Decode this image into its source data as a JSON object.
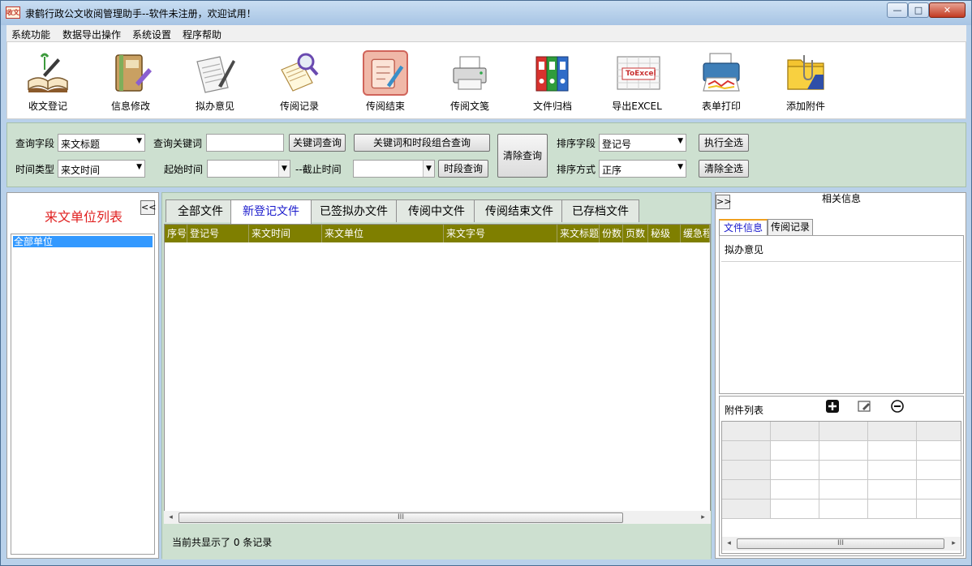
{
  "window": {
    "title": "隶鹤行政公文收阅管理助手--软件未注册，欢迎试用！",
    "icon_text": "收文",
    "minimize_label": "—",
    "maximize_label": "□",
    "close_label": "✕"
  },
  "menu": {
    "items": [
      "系统功能",
      "数据导出操作",
      "系统设置",
      "程序帮助"
    ]
  },
  "toolbar": {
    "items": [
      {
        "label": "收文登记",
        "icon": "open-book-icon"
      },
      {
        "label": "信息修改",
        "icon": "notebook-edit-icon"
      },
      {
        "label": "拟办意见",
        "icon": "document-pen-icon"
      },
      {
        "label": "传阅记录",
        "icon": "notes-magnifier-icon"
      },
      {
        "label": "传阅结束",
        "icon": "document-finish-icon"
      },
      {
        "label": "传阅文笺",
        "icon": "printer-small-icon"
      },
      {
        "label": "文件归档",
        "icon": "binders-icon"
      },
      {
        "label": "导出EXCEL",
        "icon": "excel-export-icon",
        "icon_text": "ToExcel"
      },
      {
        "label": "表单打印",
        "icon": "color-printer-icon"
      },
      {
        "label": "添加附件",
        "icon": "folder-clip-icon"
      }
    ]
  },
  "query": {
    "field_label": "查询字段",
    "field_value": "来文标题",
    "keyword_label": "查询关键词",
    "keyword_value": "",
    "keyword_search_button": "关键词查询",
    "combo_search_button": "关键词和时段组合查询",
    "clear_button": "清除查询",
    "sort_field_label": "排序字段",
    "sort_field_value": "登记号",
    "select_all_button": "执行全选",
    "time_type_label": "时间类型",
    "time_type_value": "来文时间",
    "start_label": "起始时间",
    "end_label": "--截止时间",
    "period_search_button": "时段查询",
    "sort_order_label": "排序方式",
    "sort_order_value": "正序",
    "clear_all_button": "清除全选"
  },
  "left": {
    "title": "来文单位列表",
    "collapse_label": "<<",
    "items": [
      "全部单位"
    ]
  },
  "center": {
    "tabs": [
      "全部文件",
      "新登记文件",
      "已签拟办文件",
      "传阅中文件",
      "传阅结束文件",
      "已存档文件"
    ],
    "active_tab": 1,
    "columns": [
      "序号",
      "登记号",
      "来文时间",
      "来文单位",
      "来文字号",
      "来文标题",
      "份数",
      "页数",
      "秘级",
      "缓急程"
    ],
    "rows": [],
    "status": "当前共显示了 0 条记录",
    "scroll_thumb_label": "III"
  },
  "right": {
    "title": "相关信息",
    "expand_label": ">>",
    "tabs": [
      "文件信息",
      "传阅记录"
    ],
    "opinion_label": "拟办意见",
    "attachments_label": "附件列表",
    "scroll_thumb_label": "III"
  },
  "colors": {
    "grid_header": "#7f7f00",
    "panel_green": "#cde0d0",
    "left_title": "#e02020",
    "selection": "#3399ff",
    "active_tab_text": "#1a1acc"
  }
}
